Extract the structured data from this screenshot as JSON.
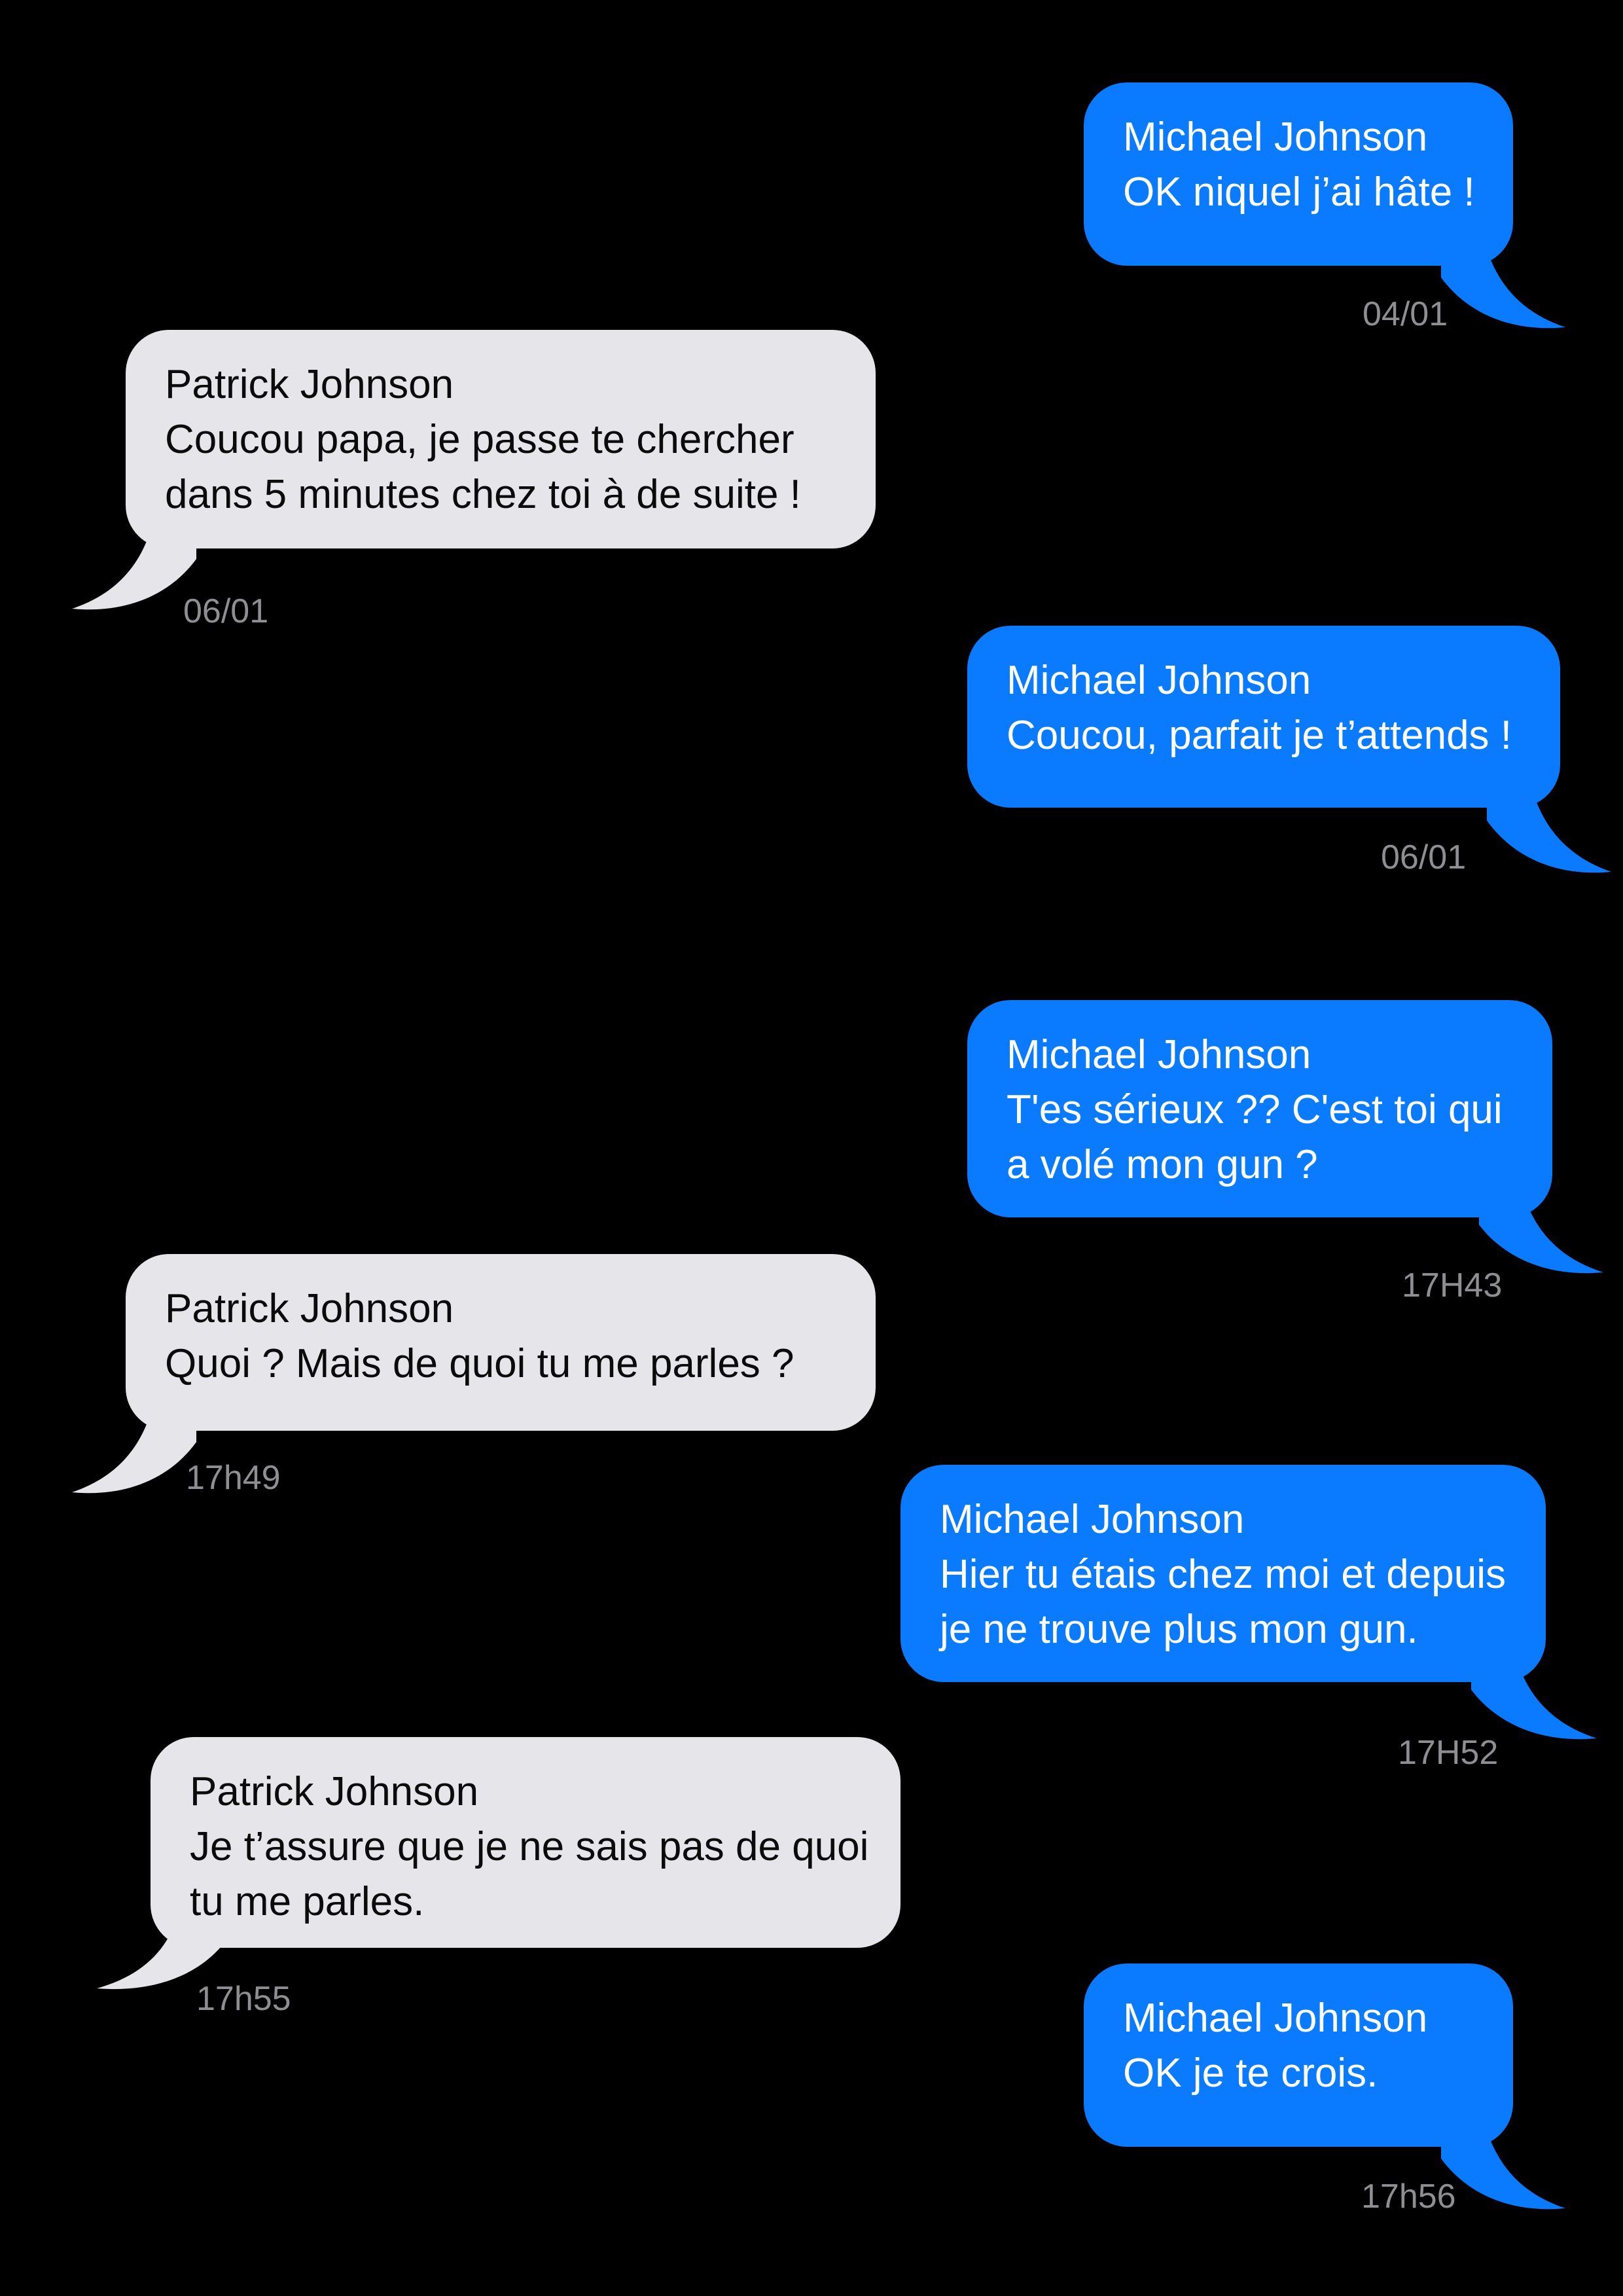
{
  "colors": {
    "background": "#000000",
    "sent_bubble": "#0a7aff",
    "received_bubble": "#e5e5ea",
    "timestamp": "#8e8e93"
  },
  "messages": [
    {
      "direction": "sent",
      "sender": "Michael Johnson",
      "lines": [
        "OK niquel j’ai hâte !"
      ],
      "time": "04/01"
    },
    {
      "direction": "received",
      "sender": "Patrick Johnson",
      "lines": [
        "Coucou papa, je passe te chercher",
        "dans 5 minutes chez toi à de suite !"
      ],
      "time": "06/01"
    },
    {
      "direction": "sent",
      "sender": "Michael Johnson",
      "lines": [
        "Coucou, parfait je t’attends !"
      ],
      "time": "06/01"
    },
    {
      "direction": "sent",
      "sender": "Michael Johnson",
      "lines": [
        "T'es sérieux ?? C'est toi qui",
        "a volé mon gun ?"
      ],
      "time": "17H43"
    },
    {
      "direction": "received",
      "sender": "Patrick Johnson",
      "lines": [
        "Quoi ? Mais de quoi tu me parles ?"
      ],
      "time": "17h49"
    },
    {
      "direction": "sent",
      "sender": "Michael Johnson",
      "lines": [
        "Hier tu étais chez moi et depuis",
        "je ne trouve plus mon gun."
      ],
      "time": "17H52"
    },
    {
      "direction": "received",
      "sender": "Patrick Johnson",
      "lines": [
        "Je t’assure que je ne sais pas de quoi",
        "tu me parles."
      ],
      "time": "17h55"
    },
    {
      "direction": "sent",
      "sender": "Michael Johnson",
      "lines": [
        "OK je te crois."
      ],
      "time": "17h56"
    }
  ]
}
